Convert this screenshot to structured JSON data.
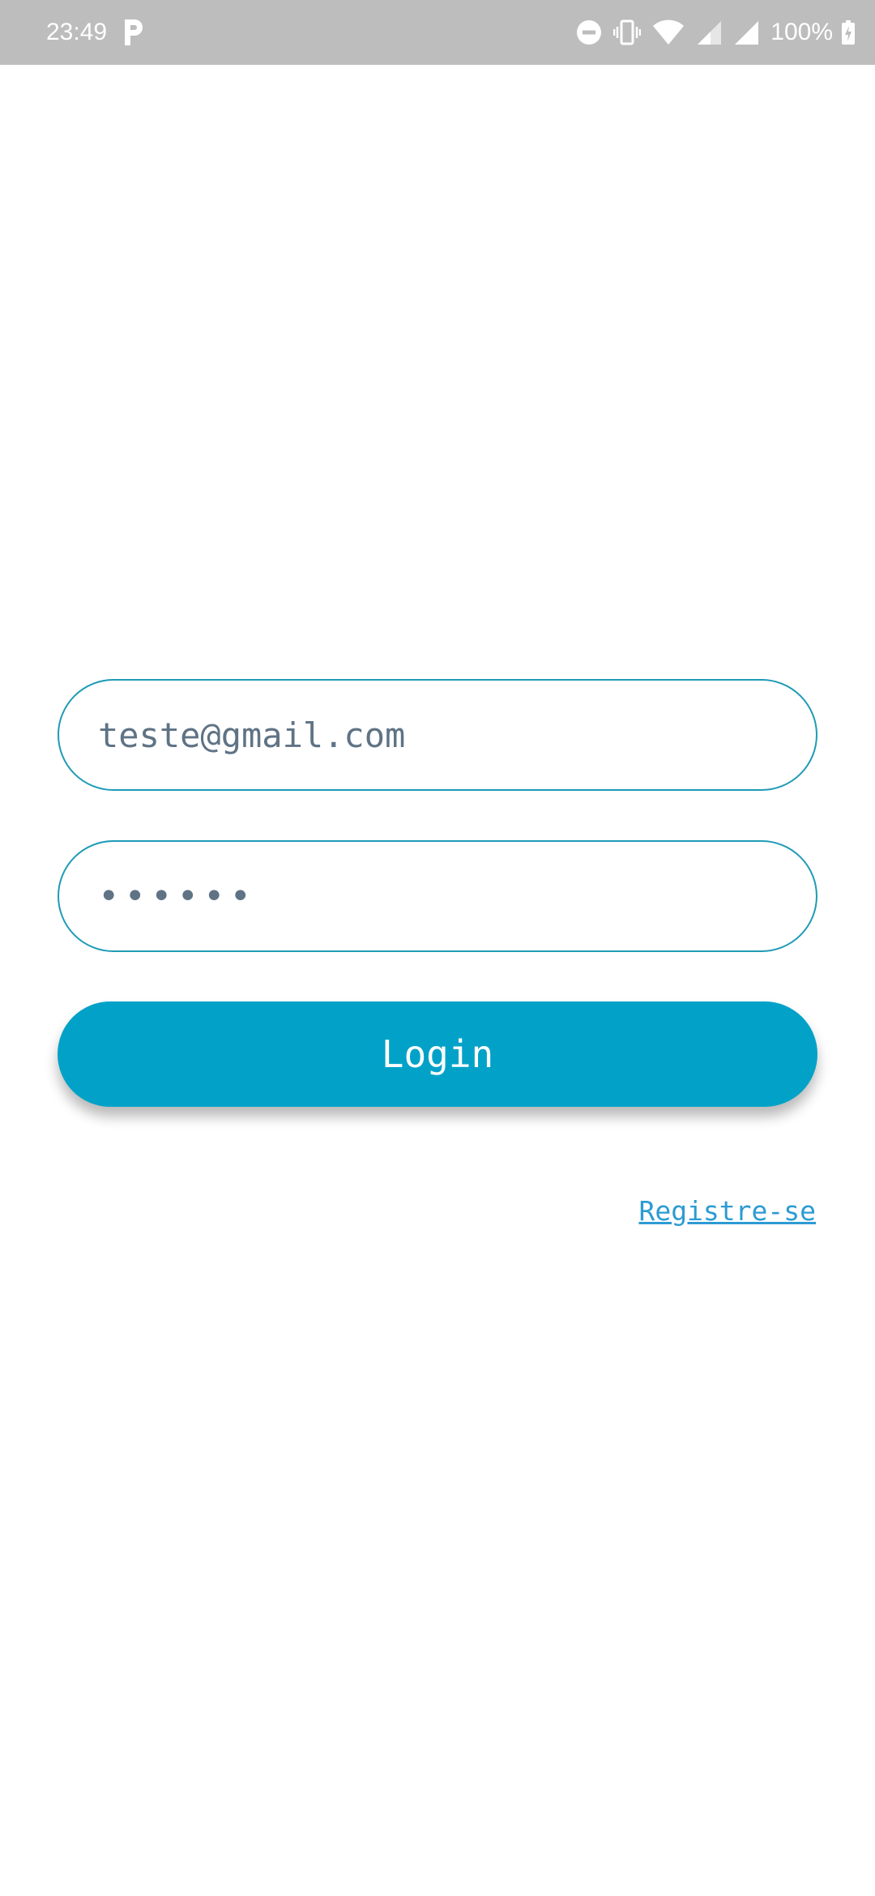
{
  "status_bar": {
    "time": "23:49",
    "battery_text": "100%",
    "icons": [
      "parking-app-icon",
      "do-not-disturb-icon",
      "vibrate-icon",
      "wifi-icon",
      "signal-icon",
      "signal-full-icon",
      "battery-charging-icon"
    ]
  },
  "login_form": {
    "email_value": "teste@gmail.com",
    "password_value": "••••••",
    "login_label": "Login",
    "register_label": "Registre-se"
  },
  "colors": {
    "accent": "#02a2c8",
    "field_border": "#1f9bb6",
    "link": "#2c9bd3",
    "status_bar": "#bdbdbd"
  }
}
